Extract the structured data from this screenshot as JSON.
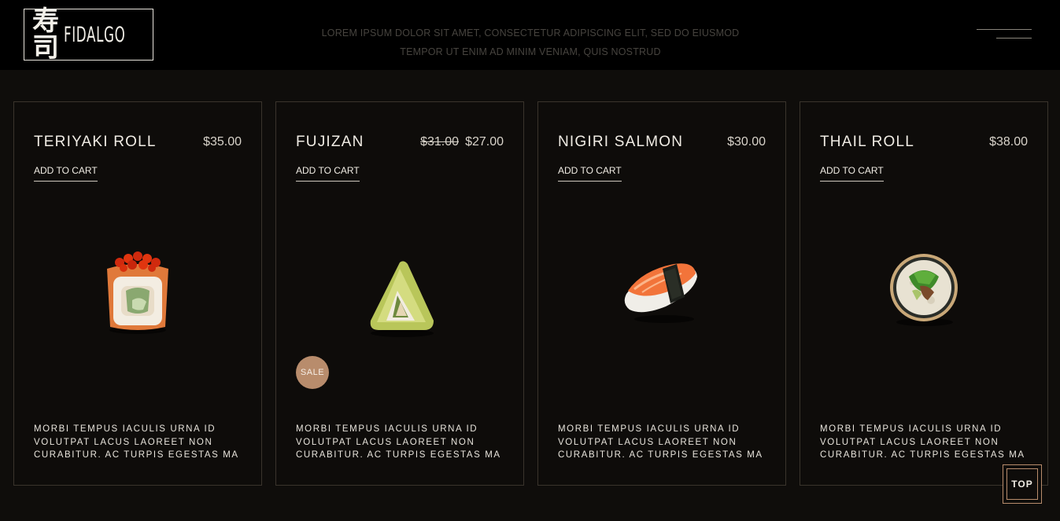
{
  "header": {
    "logo_kanji": "寿司",
    "logo_word": "FIDALGO",
    "tagline_line1": "LOREM IPSUM DOLOR SIT AMET, CONSECTETUR ADIPISCING ELIT, SED DO EIUSMOD",
    "tagline_line2": "TEMPOR UT ENIM AD MINIM VENIAM, QUIS NOSTRUD",
    "menu_icon": "hamburger-menu-icon"
  },
  "products": [
    {
      "name": "TERIYAKI ROLL",
      "price": "$35.00",
      "add_to_cart": "ADD TO CART",
      "image": "teriyaki-roll-image",
      "description": "MORBI TEMPUS IACULIS URNA ID VOLUTPAT LACUS LAOREET NON CURABITUR. AC TURPIS EGESTAS MA"
    },
    {
      "name": "FUJIZAN",
      "old_price": "$31.00",
      "price": "$27.00",
      "add_to_cart": "ADD TO CART",
      "sale_badge": "SALE",
      "image": "fujizan-image",
      "description": "MORBI TEMPUS IACULIS URNA ID VOLUTPAT LACUS LAOREET NON CURABITUR. AC TURPIS EGESTAS MA"
    },
    {
      "name": "NIGIRI SALMON",
      "price": "$30.00",
      "add_to_cart": "ADD TO CART",
      "image": "nigiri-salmon-image",
      "description": "MORBI TEMPUS IACULIS URNA ID VOLUTPAT LACUS LAOREET NON CURABITUR. AC TURPIS EGESTAS MA"
    },
    {
      "name": "THAIL ROLL",
      "price": "$38.00",
      "add_to_cart": "ADD TO CART",
      "image": "thail-roll-image",
      "description": "MORBI TEMPUS IACULIS URNA ID VOLUTPAT LACUS LAOREET NON CURABITUR. AC TURPIS EGESTAS MA"
    }
  ],
  "scroll_top": {
    "label": "TOP"
  },
  "colors": {
    "background": "#0f0d0b",
    "header": "#000000",
    "accent": "#b88c6c",
    "card_border": "#3a342c"
  }
}
